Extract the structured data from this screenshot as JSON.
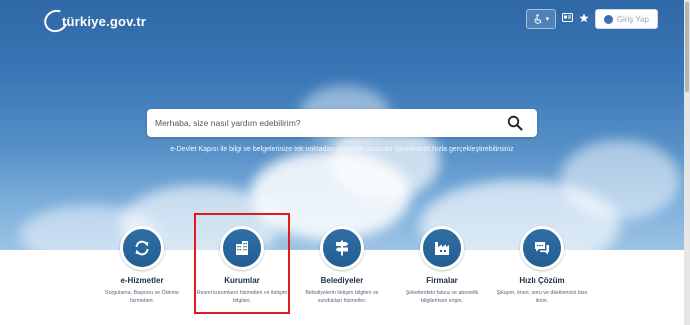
{
  "header": {
    "logo_text": "türkiye.gov.tr",
    "accessibility_icon": "accessibility-icon",
    "accessibility_caret": "▾",
    "id_card_icon": "id-card-icon",
    "favorite_icon": "star-icon",
    "login_label": "Giriş Yap"
  },
  "search": {
    "placeholder": "Merhaba, size nasıl yardım edebilirim?",
    "icon": "search-icon"
  },
  "tagline": "e-Devlet Kapısı ile bilgi ve belgelerinize tek noktadan ulaşabilir, başvuru işlemlerinizi hızla gerçekleştirebilirsiniz",
  "services": [
    {
      "title": "e-Hizmetler",
      "desc": "Sorgulama, Başvuru ve Ödeme hizmetleri.",
      "icon": "refresh-icon"
    },
    {
      "title": "Kurumlar",
      "desc": "Resmi kurumların hizmetleri ve iletişim bilgileri.",
      "icon": "building-icon"
    },
    {
      "title": "Belediyeler",
      "desc": "Belediyelerin iletişim bilgileri ve sundukları hizmetler.",
      "icon": "signpost-icon"
    },
    {
      "title": "Firmalar",
      "desc": "Şirketlerdeki fatura ve abonelik bilgilerinize erişin.",
      "icon": "factory-icon"
    },
    {
      "title": "Hızlı Çözüm",
      "desc": "Şikayet, öneri, soru ve dileklerinizi bize iletin.",
      "icon": "chat-icon"
    }
  ],
  "colors": {
    "accent": "#235d92",
    "highlight": "#e01b1b"
  }
}
